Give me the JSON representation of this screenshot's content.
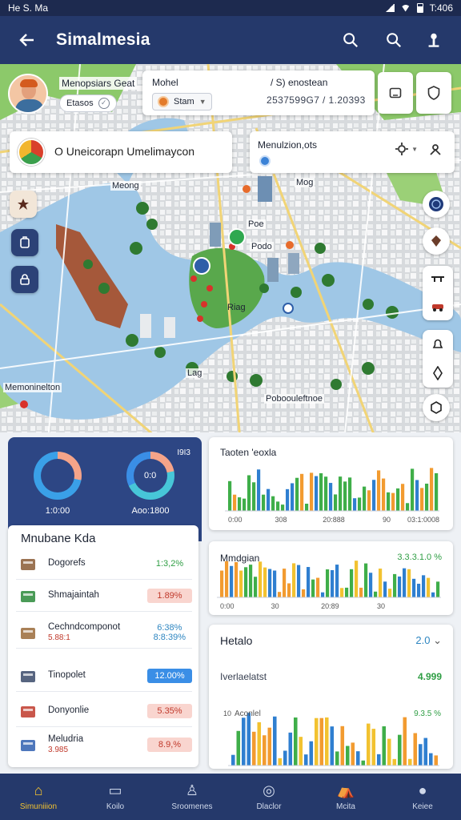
{
  "status_bar": {
    "left": "He S. Ma",
    "right": "T:406"
  },
  "app_bar": {
    "title": "Simalmesia"
  },
  "profile": {
    "name": "Menopsiars Geat",
    "chip_label": "Etasos"
  },
  "mode_card": {
    "title": "Mohel",
    "chip_label": "Stam",
    "subtitle": "/ S) enostean",
    "coords": "2537599G7 / 1.20393"
  },
  "search": {
    "text": "O  Uneicorapn  Umelimaycon"
  },
  "location_card": {
    "title": "Menulzion,ots"
  },
  "map_labels": {
    "meong": "Meong",
    "mog": "Mog",
    "pod": "Poe",
    "pod_sep": "Podo",
    "park": "Riag",
    "lag": "Lag",
    "memonimaly": "Memoninelton",
    "bottom": "Poboouleftnoe"
  },
  "donuts": {
    "badge": "I9I3",
    "left_label": "1:0:00",
    "right_label": "Aoo:1800",
    "right_center": "0:0"
  },
  "kpi": {
    "title": "Mnubane Kda",
    "rows": [
      {
        "label": "Dogorefs",
        "sub": "",
        "value": "1:3,2%",
        "style": "green"
      },
      {
        "label": "Shmajaintah",
        "sub": "",
        "value": "1.89%",
        "style": "red"
      },
      {
        "label": "Cechndcomponot",
        "sub": "5.88:1",
        "value": "6:38%\n8:8:39%",
        "style": "teal"
      },
      {
        "label": "Tinopolet",
        "sub": "",
        "value": "12.00%",
        "style": "blue"
      },
      {
        "label": "Donyonlie",
        "sub": "",
        "value": "5.35%",
        "style": "red"
      },
      {
        "label": "Meludria",
        "sub": "3.985",
        "value": "8.9,%",
        "style": "red"
      }
    ]
  },
  "chart1": {
    "title": "Taoten 'eoxla",
    "ticks": [
      "0:00",
      "308",
      "20:888",
      "90",
      "03:1:0008"
    ]
  },
  "chart2": {
    "title": "Mmdgian",
    "right": "3.3.3.1.0 %",
    "ticks": [
      "0:00",
      "30",
      "20:89",
      "30"
    ]
  },
  "chart3": {
    "title": "Hetalo",
    "right": "2.0",
    "row_label": "Iverlaelatst",
    "row_value": "4.999",
    "axis_label": "Aconlel",
    "pct": "9.3.5 %",
    "tick": "10"
  },
  "nav": [
    "Simuniiion",
    "Koilo",
    "Sroomenes",
    "Dlaclor",
    "Mcita",
    "Keiee"
  ],
  "colors": {
    "primary": "#25396b",
    "accent": "#f2c230",
    "green": "#3fae49",
    "orange": "#f29b30",
    "blue": "#2f7fd0"
  }
}
